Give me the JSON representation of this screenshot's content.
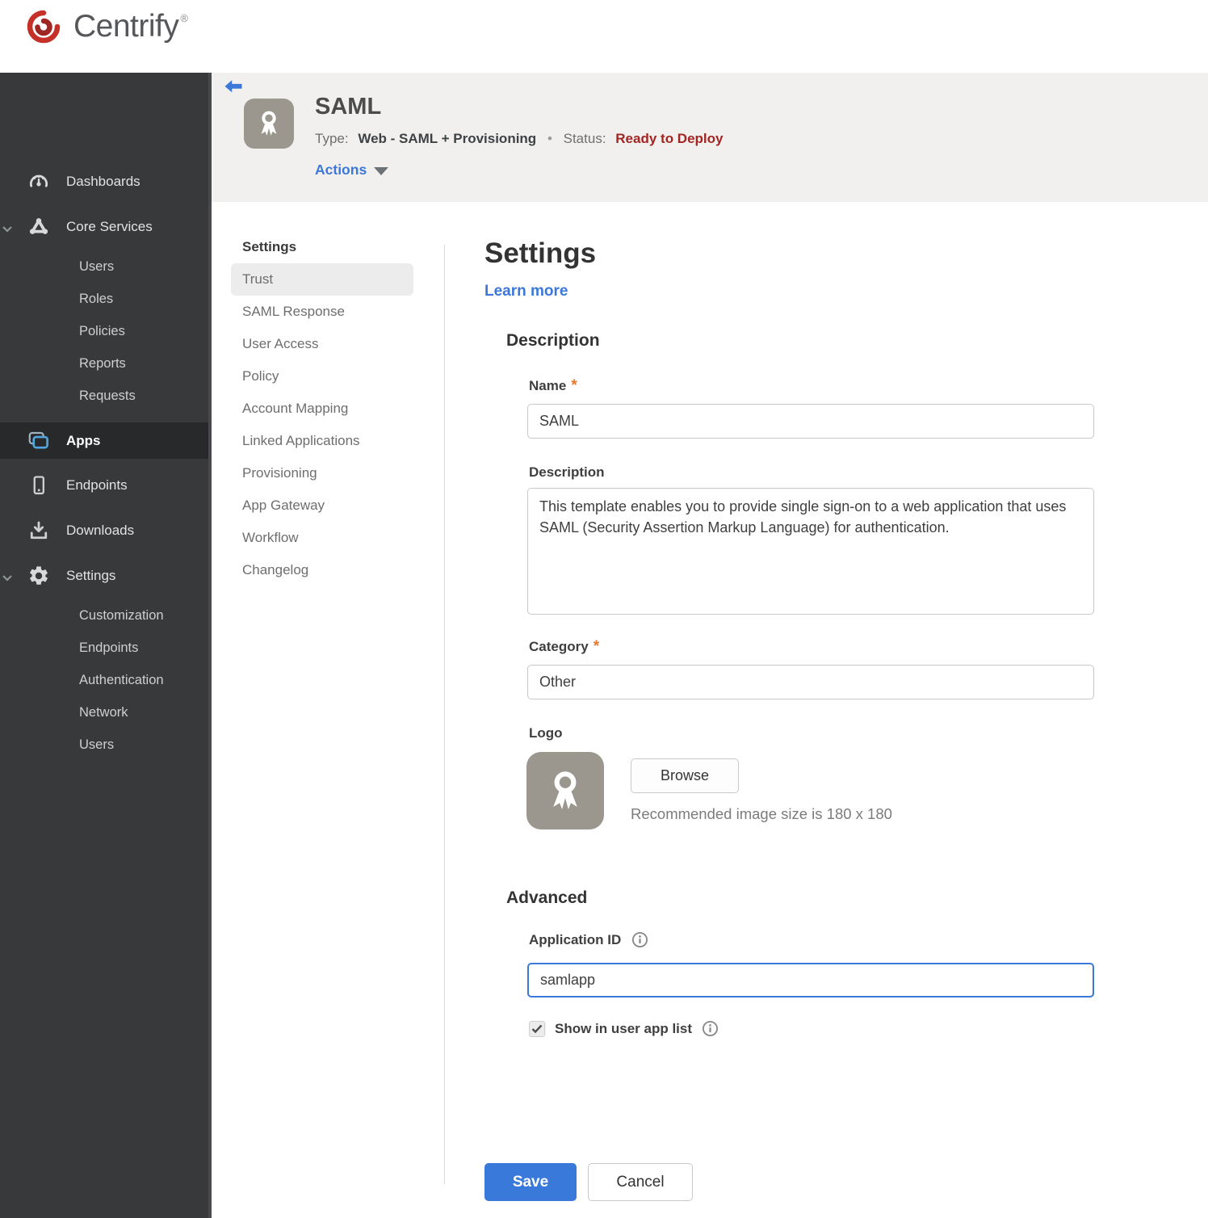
{
  "brand": {
    "name": "Centrify",
    "registered": "®"
  },
  "colors": {
    "accent_blue": "#3b78d8",
    "save_blue": "#3879da",
    "status_red": "#a32421",
    "required_orange": "#e8762c",
    "sidebar_bg": "#38393b",
    "header_band_bg": "#f1f0ee",
    "app_icon_gray": "#9b978f"
  },
  "sidebar": {
    "items": [
      {
        "label": "Dashboards",
        "level": "top"
      },
      {
        "label": "Core Services",
        "level": "top",
        "expanded": true
      },
      {
        "label": "Users",
        "level": "sub"
      },
      {
        "label": "Roles",
        "level": "sub"
      },
      {
        "label": "Policies",
        "level": "sub"
      },
      {
        "label": "Reports",
        "level": "sub"
      },
      {
        "label": "Requests",
        "level": "sub"
      },
      {
        "label": "Apps",
        "level": "top",
        "active": true
      },
      {
        "label": "Endpoints",
        "level": "top"
      },
      {
        "label": "Downloads",
        "level": "top"
      },
      {
        "label": "Settings",
        "level": "top",
        "expanded": true
      },
      {
        "label": "Customization",
        "level": "sub"
      },
      {
        "label": "Endpoints",
        "level": "sub"
      },
      {
        "label": "Authentication",
        "level": "sub"
      },
      {
        "label": "Network",
        "level": "sub"
      },
      {
        "label": "Users",
        "level": "sub"
      }
    ]
  },
  "header": {
    "title": "SAML",
    "type_label": "Type:",
    "type_value": "Web - SAML + Provisioning",
    "separator": "•",
    "status_label": "Status:",
    "status_value": "Ready to Deploy",
    "actions_label": "Actions"
  },
  "subnav": {
    "header": "Settings",
    "selected": "Trust",
    "items": [
      {
        "label": "Trust",
        "selected": true
      },
      {
        "label": "SAML Response"
      },
      {
        "label": "User Access"
      },
      {
        "label": "Policy"
      },
      {
        "label": "Account Mapping"
      },
      {
        "label": "Linked Applications"
      },
      {
        "label": "Provisioning"
      },
      {
        "label": "App Gateway"
      },
      {
        "label": "Workflow"
      },
      {
        "label": "Changelog"
      }
    ]
  },
  "main": {
    "title": "Settings",
    "learn_more": "Learn more",
    "description_section": {
      "heading": "Description",
      "name_label": "Name",
      "required_mark": "*",
      "name_value": "SAML",
      "description_label": "Description",
      "description_value": "This template enables you to provide single sign-on to a web application that uses SAML (Security Assertion Markup Language) for authentication.",
      "category_label": "Category",
      "category_value": "Other",
      "logo_label": "Logo",
      "browse_label": "Browse",
      "recommended_text": "Recommended image size is 180 x 180"
    },
    "advanced_section": {
      "heading": "Advanced",
      "application_id_label": "Application ID",
      "application_id_value": "samlapp",
      "show_in_app_list_label": "Show in user app list",
      "checkbox_checked": true
    },
    "footer": {
      "save_label": "Save",
      "cancel_label": "Cancel"
    }
  }
}
